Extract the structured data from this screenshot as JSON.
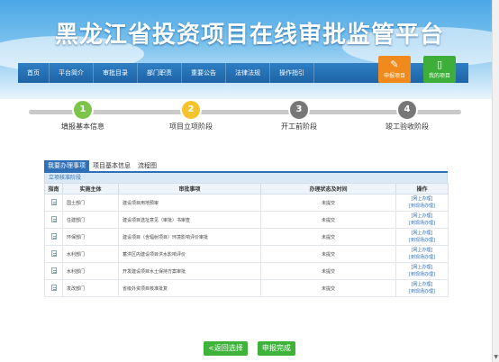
{
  "header": {
    "title": "黑龙江省投资项目在线审批监管平台"
  },
  "nav": {
    "items": [
      "首页",
      "平台简介",
      "审批目录",
      "部门职责",
      "重要公告",
      "法律法规",
      "操作指引"
    ]
  },
  "quick_buttons": {
    "apply": "申报项目",
    "my_projects": "我的项目"
  },
  "steps": [
    {
      "num": "1",
      "label": "填报基本信息"
    },
    {
      "num": "2",
      "label": "项目立项阶段"
    },
    {
      "num": "3",
      "label": "开工前阶段"
    },
    {
      "num": "4",
      "label": "竣工验收阶段"
    }
  ],
  "tabs": [
    "我要办理事项",
    "项目基本信息",
    "流程图"
  ],
  "stage_title": "立项核准阶段",
  "table": {
    "headers": [
      "指南",
      "实施主体",
      "审批事项",
      "办理状态及时间",
      "操作"
    ],
    "rows": [
      {
        "dept": "国土部门",
        "item": "建设项目用地预审",
        "status": "未提交",
        "op1": "[网上办理]",
        "op2": "[到现场办理]"
      },
      {
        "dept": "住建部门",
        "item": "建设项目选址意见（审批）书审查",
        "status": "未提交",
        "op1": "[网上办理]",
        "op2": "[到现场办理]"
      },
      {
        "dept": "环保部门",
        "item": "建设项目（含辐射项目）环境影响评价审批",
        "status": "未提交",
        "op1": "[网上办理]",
        "op2": "[到现场办理]"
      },
      {
        "dept": "水利部门",
        "item": "蓄洪区内建设项目洪水影响评价",
        "status": "未提交",
        "op1": "[网上办理]",
        "op2": "[到现场办理]"
      },
      {
        "dept": "水利部门",
        "item": "开发建设项目水土保持方案审批",
        "status": "未提交",
        "op1": "[网上办理]",
        "op2": "[到现场办理]"
      },
      {
        "dept": "发改部门",
        "item": "省级外资项目核准批复",
        "status": "未提交",
        "op1": "[网上办理]",
        "op2": "[到现场办理]"
      }
    ]
  },
  "buttons": {
    "back": "<返回选择",
    "finish": "申报完成"
  },
  "colors": {
    "nav": "#1d63a6",
    "accent_green": "#3eb33a",
    "accent_orange": "#f08a1c",
    "step_done": "#7cc44a",
    "step_current": "#f5c32c",
    "step_todo": "#777777"
  },
  "icons": {
    "apply": "edit-icon",
    "my_projects": "document-icon",
    "guide": "doc-icon",
    "scroll": "chevron-down-icon"
  }
}
